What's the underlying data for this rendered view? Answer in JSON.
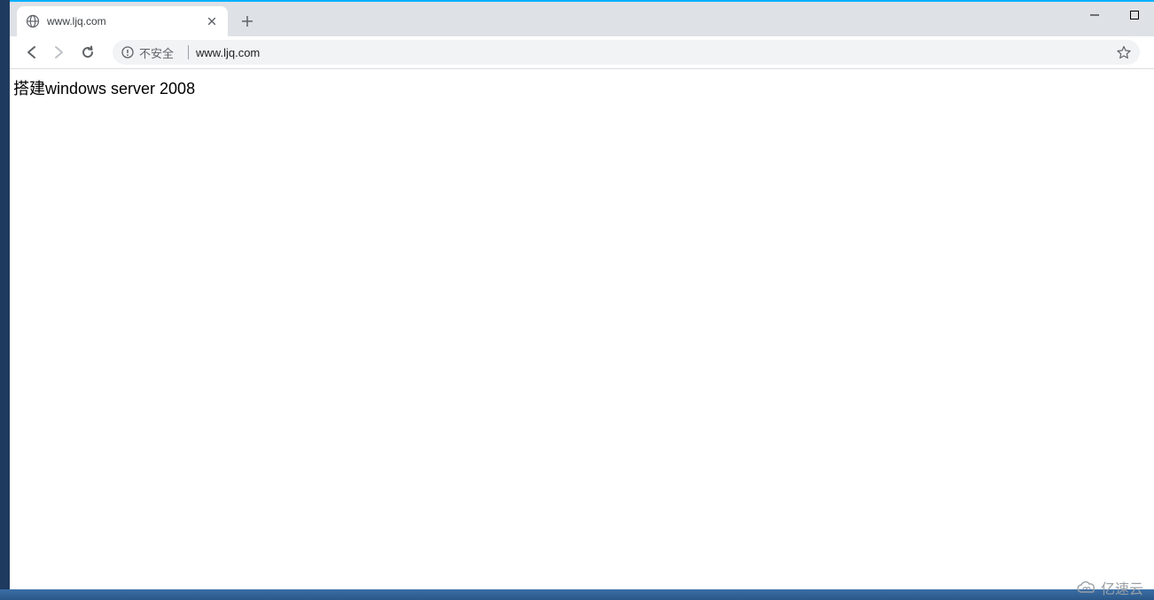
{
  "tab": {
    "title": "www.ljq.com"
  },
  "toolbar": {
    "security_label": "不安全",
    "url": "www.ljq.com"
  },
  "page": {
    "heading": "搭建windows server 2008"
  },
  "watermark": {
    "text": "亿速云"
  }
}
